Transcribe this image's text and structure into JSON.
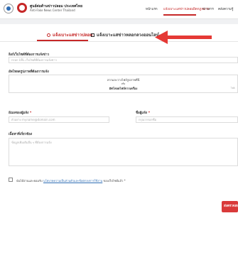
{
  "header": {
    "brand_th": "ศูนย์ต่อต้านข่าวปลอม ประเทศไทย",
    "brand_en": "Anti-Fake News Center Thailand",
    "nav": [
      {
        "label": "หน้าแรก"
      },
      {
        "label": "แจ้งเบาะแสข่าวปลอมผิดกฎหมาย"
      },
      {
        "label": "ข่าวสาร"
      },
      {
        "label": "คลังความรู้"
      }
    ]
  },
  "tabs": [
    {
      "label": "แจ้งเบาะแสข่าวปลอม"
    },
    {
      "label": "แจ้งเบาะแสข่าวหลอกลวงออนไลน์"
    }
  ],
  "form": {
    "link_label": "ลิงก์เว็บไซต์ที่ต้องการแจ้งข่าว",
    "link_placeholder": "กรอก URL  เว็บไซต์ที่ต้องการแจ้งข่าว",
    "upload_label": "อัพโหลดรูปภาพที่ต้องการแจ้ง",
    "upload_line1": "ลากและวางไฟล์รูปภาพที่นี่",
    "upload_line2": "หรือ",
    "upload_line3": "อัพโหลดไฟล์จากเครื่อง",
    "upload_note": "ไฟล์",
    "email_label": "อีเมลของผู้แจ้ง",
    "email_placeholder": "ตัวอย่าง   myname@domain.com",
    "name_label": "ชื่อผู้แจ้ง",
    "name_placeholder": "กรุณากรอกชื่อ",
    "required_mark": "*",
    "details_label": "เนื้อหาที่เกี่ยวข้อง",
    "details_placeholder": "ข้อมูลเพิ่มเติมอื่น ๆ ที่ต้องการแจ้ง",
    "consent_prefix": "ฉันได้อ่านและยอมรับ ",
    "consent_link": "นโยบายความเป็นส่วนตัวและข้อตกลงการใช้งาน",
    "consent_suffix": " ของเว็บไซต์แล้ว *",
    "submit_label": "ส่งตรวจสอบ"
  },
  "colors": {
    "accent": "#c62828",
    "arrow": "#e53935",
    "submit": "#d93a3a",
    "link": "#2e6db4"
  }
}
